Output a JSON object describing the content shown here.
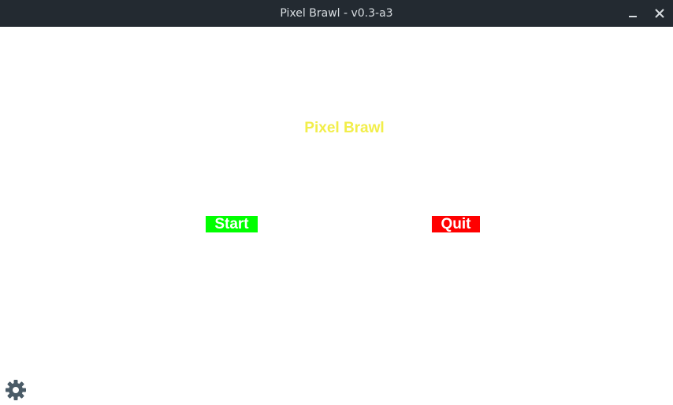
{
  "window": {
    "title": "Pixel Brawl - v0.3-a3"
  },
  "menu": {
    "game_title": "Pixel Brawl",
    "start_label": "Start",
    "quit_label": "Quit"
  },
  "icons": {
    "minimize": "minimize-icon",
    "close": "close-icon",
    "settings": "gear-icon"
  },
  "colors": {
    "titlebar_bg": "#232a31",
    "title_text": "#f2ee4a",
    "start_bg": "#00ff00",
    "quit_bg": "#ff0000",
    "gear": "#4a5b67"
  }
}
